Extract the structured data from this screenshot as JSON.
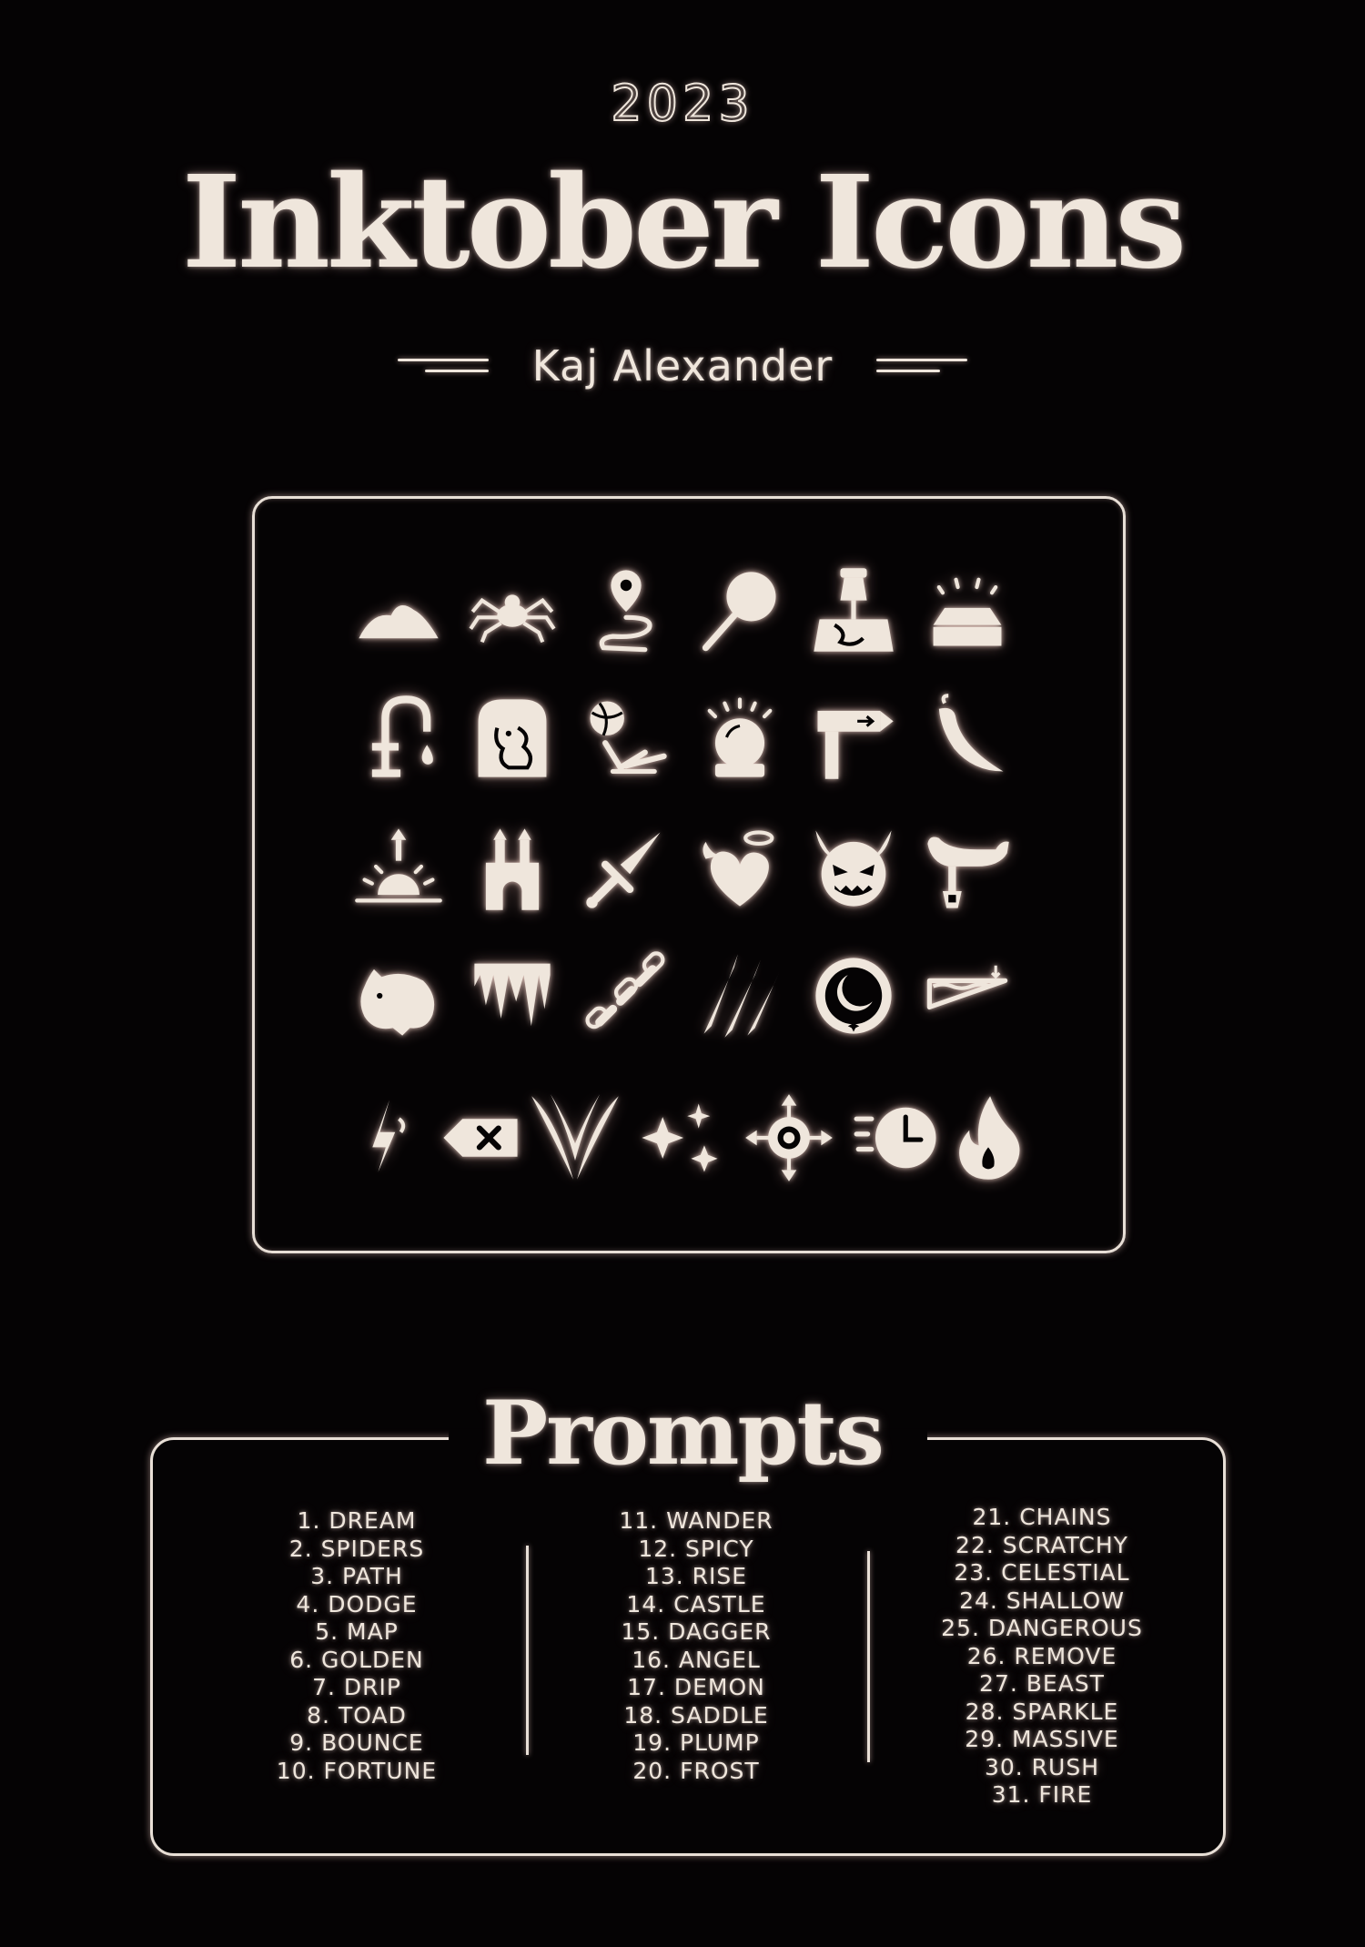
{
  "poster": {
    "year": "2023",
    "title": "Inktober Icons",
    "author": "Kaj Alexander",
    "prompts_heading": "Prompts"
  },
  "colors": {
    "background": "#050304",
    "ink": "#efe6dc",
    "glow": "#ffd6cc"
  },
  "icons": [
    "cloud-moon-icon",
    "spider-icon",
    "path-pin-icon",
    "lollipop-icon",
    "map-pin-icon",
    "gold-bar-icon",
    "faucet-drip-icon",
    "toad-icon",
    "bouncing-ball-icon",
    "crystal-ball-icon",
    "signpost-icon",
    "chili-pepper-icon",
    "sunrise-icon",
    "castle-icon",
    "dagger-icon",
    "angel-heart-icon",
    "demon-face-icon",
    "saddle-icon",
    "plump-blob-icon",
    "icicles-icon",
    "chain-icon",
    "scratch-marks-icon",
    "moon-star-circle-icon",
    "shallow-water-icon",
    "lightning-icon",
    "backspace-remove-icon",
    "beast-claw-icon",
    "sparkles-icon",
    "compass-target-icon",
    "rushing-clock-icon",
    "flame-icon"
  ],
  "prompts": {
    "col1": [
      "1. DREAM",
      "2. SPIDERS",
      "3. PATH",
      "4. DODGE",
      "5. MAP",
      "6. GOLDEN",
      "7. DRIP",
      "8. TOAD",
      "9. BOUNCE",
      "10. FORTUNE"
    ],
    "col2": [
      "11. WANDER",
      "12. SPICY",
      "13. RISE",
      "14. CASTLE",
      "15. DAGGER",
      "16. ANGEL",
      "17. DEMON",
      "18. SADDLE",
      "19. PLUMP",
      "20. FROST"
    ],
    "col3": [
      "21. CHAINS",
      "22. SCRATCHY",
      "23. CELESTIAL",
      "24. SHALLOW",
      "25. DANGEROUS",
      "26. REMOVE",
      "27. BEAST",
      "28. SPARKLE",
      "29. MASSIVE",
      "30. RUSH",
      "31. FIRE"
    ]
  }
}
